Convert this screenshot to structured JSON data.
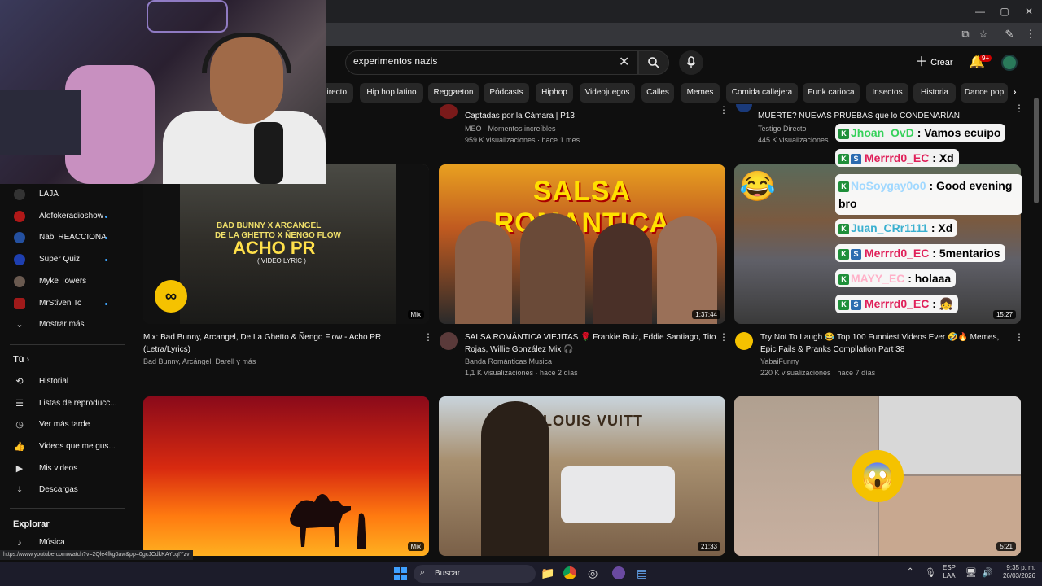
{
  "search": {
    "query": "experimentos nazis"
  },
  "header": {
    "create_label": "Crear",
    "notif_count": "9+"
  },
  "chips": [
    "directo",
    "Hip hop latino",
    "Reggaeton",
    "Pódcasts",
    "Hiphop",
    "Videojuegos",
    "Calles",
    "Memes",
    "Comida callejera",
    "Funk carioca",
    "Insectos",
    "Historia",
    "Dance pop"
  ],
  "sidebar": {
    "subscriptions": [
      "LAJA",
      "Alofokeradioshow",
      "Nabi REACCIONA",
      "Super Quiz",
      "Myke Towers",
      "MrStiven Tc"
    ],
    "show_more": "Mostrar más",
    "you_heading": "Tú",
    "you_items": [
      "Historial",
      "Listas de reproducc...",
      "Ver más tarde",
      "Videos que me gus...",
      "Mis videos",
      "Descargas"
    ],
    "explore_heading": "Explorar",
    "explore_items": [
      "Música"
    ]
  },
  "top_row": [
    {
      "title": "Captadas por la Cámara | P13",
      "channel": "MEO · Momentos increíbles",
      "meta": "959 K visualizaciones · hace 1 mes"
    },
    {
      "title": "MUERTE? NUEVAS PRUEBAS que lo CONDENARÍAN",
      "channel": "Testigo Directo",
      "meta": "445 K visualizaciones"
    }
  ],
  "videos": [
    {
      "title": "Mix: Bad Bunny, Arcangel, De La Ghetto & Ñengo Flow - Acho PR (Letra/Lyrics)",
      "channel": "Bad Bunny, Arcángel, Darell y más",
      "meta": "",
      "badge": "Mix",
      "thumb_text1": "BAD BUNNY X ARCANGEL",
      "thumb_text2": "DE LA GHETTO X ÑENGO FLOW",
      "thumb_text3": "ACHO PR",
      "thumb_text4": "( VIDEO LYRIC )"
    },
    {
      "title": "SALSA ROMÁNTICA VIEJITAS 🌹 Frankie Ruiz, Eddie Santiago, Tito Rojas, Willie González Mix 🎧",
      "channel": "Banda Románticas Musica",
      "meta": "1,1 K visualizaciones · hace 2 días",
      "badge": "1:37:44",
      "thumb_text1": "SALSA ROMANTICA"
    },
    {
      "title": "Try Not To Laugh 😂 Top 100 Funniest Videos Ever 🤣🔥 Memes, Epic Fails & Pranks Compilation Part 38",
      "channel": "YabaiFunny",
      "meta": "220 K visualizaciones · hace 7 días",
      "badge": "15:27"
    }
  ],
  "row3_badges": [
    "Mix",
    "21:33",
    "5:21"
  ],
  "row3_sign": "LOUIS VUITT",
  "chat": [
    {
      "user": "Jhoan_OvD",
      "msg": ": Vamos ecuipo"
    },
    {
      "user": "Merrrd0_EC",
      "msg": ": Xd"
    },
    {
      "user": "NoSoygay0o0",
      "msg": ": Good evening bro"
    },
    {
      "user": "Juan_CRr1111",
      "msg": ": Xd"
    },
    {
      "user": "Merrrd0_EC",
      "msg": ": 5mentarios"
    },
    {
      "user": "MAYY_EC",
      "msg": ": holaaa"
    },
    {
      "user": "Merrrd0_EC",
      "msg": ":"
    }
  ],
  "statusbar": {
    "url": "https://www.youtube.com/watch?v=2Qle4fkg0aw&pp=0gcJCdkKAYcqIYzv"
  },
  "taskbar": {
    "search_label": "Buscar",
    "lang1": "ESP",
    "lang2": "LAA",
    "time": "9:35 p. m.",
    "date": "26/03/2026"
  }
}
